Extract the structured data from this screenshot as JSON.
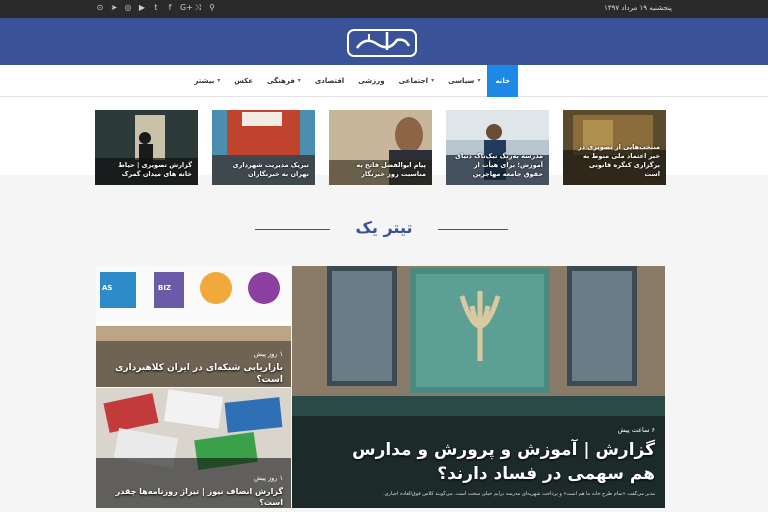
{
  "topbar": {
    "date": "پنجشنبه ۱۹ مرداد ۱۳۹۷",
    "socials": [
      "rss-icon",
      "telegram-icon",
      "instagram-icon",
      "youtube-icon",
      "twitter-icon",
      "facebook-icon",
      "google-plus-icon",
      "shuffle-icon",
      "search-icon"
    ],
    "social_glyphs": [
      "⊙",
      "➤",
      "◎",
      "▶",
      "t",
      "f",
      "G+",
      "⤨",
      "⚲"
    ]
  },
  "logo": {
    "text": "انصاف"
  },
  "nav": [
    {
      "label": "خانه",
      "active": true,
      "caret": false
    },
    {
      "label": "سیاسی",
      "active": false,
      "caret": true
    },
    {
      "label": "اجتماعی",
      "active": false,
      "caret": true
    },
    {
      "label": "ورزشی",
      "active": false,
      "caret": false
    },
    {
      "label": "اقتصادی",
      "active": false,
      "caret": false
    },
    {
      "label": "فرهنگی",
      "active": false,
      "caret": true
    },
    {
      "label": "عکس",
      "active": false,
      "caret": false
    },
    {
      "label": "بیشتر",
      "active": false,
      "caret": true
    }
  ],
  "thumbs": [
    {
      "caption": "منتخب‌هایی از تصویری در خبر اعتماد ملی منوط به برگزاری کنگره قانونی است"
    },
    {
      "caption": "مدرسه به‌رنگ تیک‌تاک دنیای آموزش؛ برای هیأت از حقوق جامعه مهاجرین"
    },
    {
      "caption": "پیام ابوالفضل فاتح به مناسبت روز خبرنگار"
    },
    {
      "caption": "تبریک مدیریت شهرداری تهران به خبرنگاران"
    },
    {
      "caption": "گزارش تصویری | حیاط خانه های میدان گمرک"
    }
  ],
  "section": {
    "title": "تیتر یک"
  },
  "main_card": {
    "time": "۶ ساعت پیش",
    "title": "گزارش | آموزش و پرورش و مدارس هم سهمی در فساد دارند؟",
    "excerpt": "مدیر می‌گفت «تمام طرح خانه ما هم است» و پرداخت شهریه‌ای مدرسه برایم خیلی سخت است. می‌گویند کلاس فوق‌العاده اجباری."
  },
  "side_cards": [
    {
      "time": "۱ روز پیش",
      "title": "بازاریابی شبکه‌ای در ایران کلاهبرداری است؟"
    },
    {
      "time": "۱ روز پیش",
      "title": "گزارش انصاف نیوز | تیراژ روزنامه‌ها چقدر است؟"
    }
  ],
  "brand_logos": [
    "AS",
    "BIZ",
    "BIZ",
    "●"
  ],
  "colors": {
    "header": "#3a5298",
    "nav_active": "#1e88e5",
    "section_title": "#3a5298"
  }
}
